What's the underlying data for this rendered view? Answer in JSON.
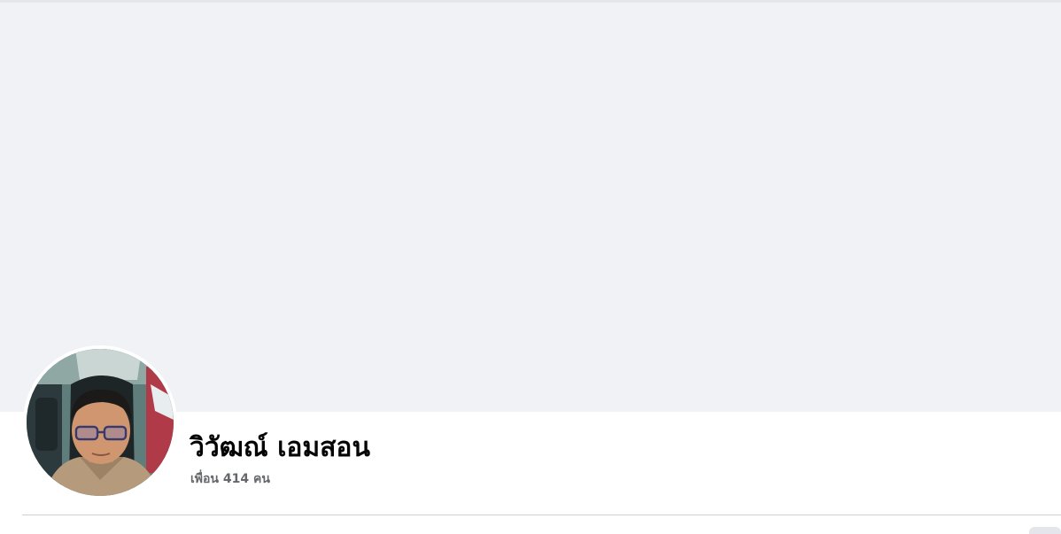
{
  "profile": {
    "name": "วิวัฒณ์ เอมสอน",
    "friends": "เพื่อน 414 คน"
  },
  "colors": {
    "cover_bg": "#f0f2f5",
    "name_text": "#050505",
    "secondary_text": "#65676b",
    "divider": "#ced0d4"
  },
  "icons": {
    "avatar": "profile-photo"
  }
}
